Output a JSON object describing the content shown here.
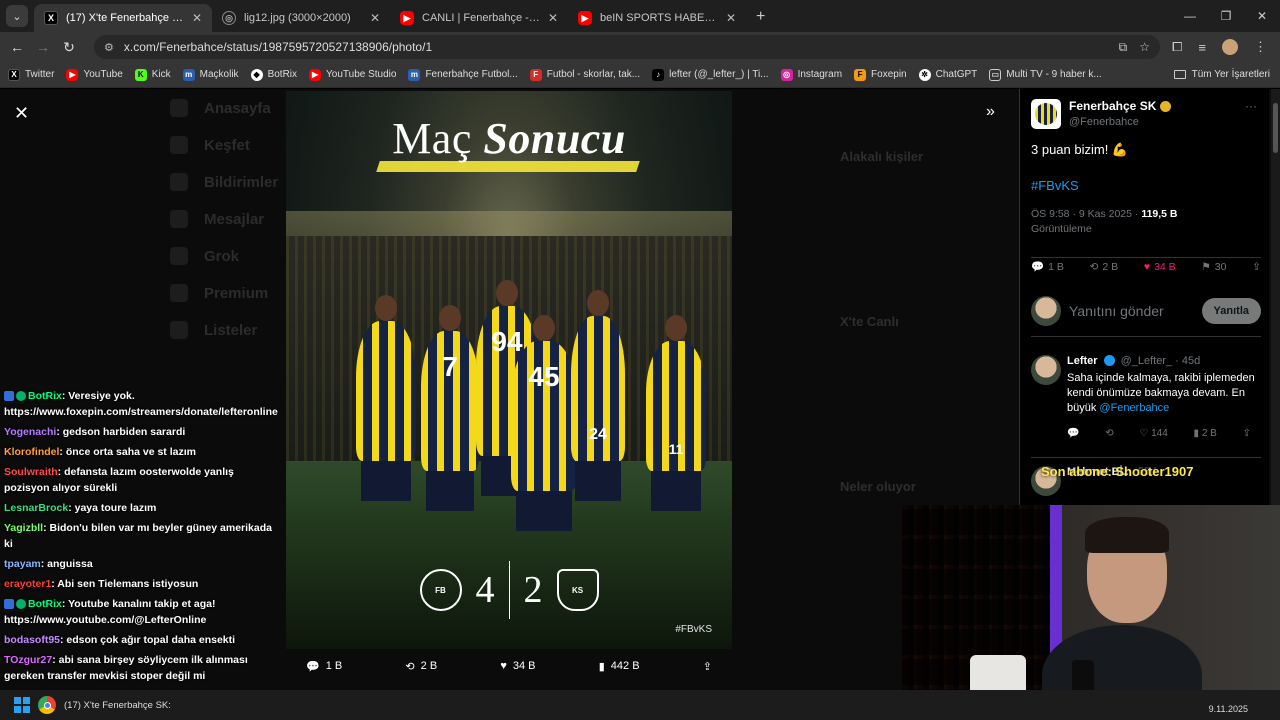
{
  "browser": {
    "tabs": [
      {
        "title": "(17) X'te Fenerbahçe SK: \"3 pua",
        "icon": "x-icon"
      },
      {
        "title": "lig12.jpg (3000×2000)",
        "icon": "image-icon"
      },
      {
        "title": "CANLI | Fenerbahçe - Zecor",
        "icon": "youtube-icon"
      },
      {
        "title": "beIN SPORTS HABER Canlı Yayın",
        "icon": "youtube-icon"
      }
    ],
    "url": "x.com/Fenerbahce/status/1987595720527138906/photo/1"
  },
  "bookmarks": [
    {
      "label": "Twitter",
      "icon": "x-icon"
    },
    {
      "label": "YouTube",
      "icon": "youtube-icon"
    },
    {
      "label": "Kick",
      "icon": "kick-icon"
    },
    {
      "label": "Maçkolik",
      "icon": "mackolik-icon"
    },
    {
      "label": "BotRix",
      "icon": "botrix-icon"
    },
    {
      "label": "YouTube Studio",
      "icon": "youtube-icon"
    },
    {
      "label": "Fenerbahçe Futbol...",
      "icon": "mackolik-icon"
    },
    {
      "label": "Futbol - skorlar, tak...",
      "icon": "flashscore-icon"
    },
    {
      "label": "lefter (@_lefter_) | Ti...",
      "icon": "tiktok-icon"
    },
    {
      "label": "Instagram",
      "icon": "instagram-icon"
    },
    {
      "label": "Foxepin",
      "icon": "foxepin-icon"
    },
    {
      "label": "ChatGPT",
      "icon": "chatgpt-icon"
    },
    {
      "label": "Multi TV - 9 haber k...",
      "icon": "tv-icon"
    }
  ],
  "bookmarks_all": "Tüm Yer İşaretleri",
  "photo": {
    "title_part1": "Maç",
    "title_part2": "Sonucu",
    "home_score": "4",
    "away_score": "2",
    "home_crest": "FB",
    "away_crest": "KS",
    "hashtag": "#FBvKS",
    "jersey_numbers": [
      "94",
      "45",
      "24",
      "7",
      "11"
    ]
  },
  "photo_actions": {
    "replies": "1 B",
    "reposts": "2 B",
    "likes": "34 B",
    "views": "442 B"
  },
  "chat": [
    {
      "user": "BotRix",
      "color": "#00ff7f",
      "text": ": Veresiye yok. https://www.foxepin.com/streamers/donate/lefteronline",
      "badges": true
    },
    {
      "user": "Yogenachi",
      "color": "#b57cff",
      "text": ": gedson harbiden sarardi"
    },
    {
      "user": "Klorofindel",
      "color": "#ff9f3d",
      "text": ": önce orta saha ve st lazım"
    },
    {
      "user": "Soulwraith",
      "color": "#ff4a4a",
      "text": ": defansta lazım oosterwolde yanlış pozisyon alıyor sürekli"
    },
    {
      "user": "LesnarBrock",
      "color": "#3ddc84",
      "text": ": yaya toure lazım"
    },
    {
      "user": "Yagizbll",
      "color": "#7cfc6a",
      "text": ": Bidon'u bilen var mı beyler güney amerikada ki"
    },
    {
      "user": "tpayam",
      "color": "#8ab4ff",
      "text": ": anguissa"
    },
    {
      "user": "erayoter1",
      "color": "#ff3d3d",
      "text": ": Abi sen Tielemans istiyosun"
    },
    {
      "user": "BotRix",
      "color": "#00ff7f",
      "text": ": Youtube kanalını takip et aga! https://www.youtube.com/@LefterOnline",
      "badges": true
    },
    {
      "user": "bodasoft95",
      "color": "#c48bff",
      "text": ": edson çok ağır topal daha ensekti"
    },
    {
      "user": "TOzgur27",
      "color": "#d86bff",
      "text": ": abi sana birşey söyliycem ilk alınması gereken transfer mevkisi stoper değil mi"
    }
  ],
  "sidebar": {
    "name": "Fenerbahçe SK",
    "handle": "@Fenerbahce",
    "text": "3 puan bizim! 💪",
    "hashtag": "#FBvKS",
    "time": "ÖS 9:58 · 9 Kas 2025 · ",
    "views": "119,5 B",
    "views_label": "Görüntüleme",
    "replies": "1 B",
    "reposts": "2 B",
    "likes": "34 B",
    "bookmarks": "30",
    "reply_placeholder": "Yanıtını gönder",
    "reply_button": "Yanıtla",
    "tweet2": {
      "name": "Lefter",
      "handle": "@_Lefter_ · 45d",
      "text": "Saha içinde kalmaya, rakibi iplemeden kendi önümüze bakmaya devam. En büyük ",
      "mention": "@Fenerbahce",
      "likes": "144",
      "views": "2 B"
    },
    "tweet3": {
      "name": "Mehmet Bİ...",
      "handle": "55d"
    }
  },
  "overlay_text": "Son abone: Shooter1907",
  "ghost": {
    "nav": [
      "Anasayfa",
      "Keşfet",
      "Bildirimler",
      "Mesajlar",
      "Grok",
      "Premium",
      "Listeler"
    ],
    "mid": [
      "Alakalı kişiler",
      "X'te Canlı",
      "Neler oluyor"
    ]
  },
  "taskbar": {
    "app_label": "(17) X'te Fenerbahçe SK:",
    "date": "9.11.2025"
  }
}
